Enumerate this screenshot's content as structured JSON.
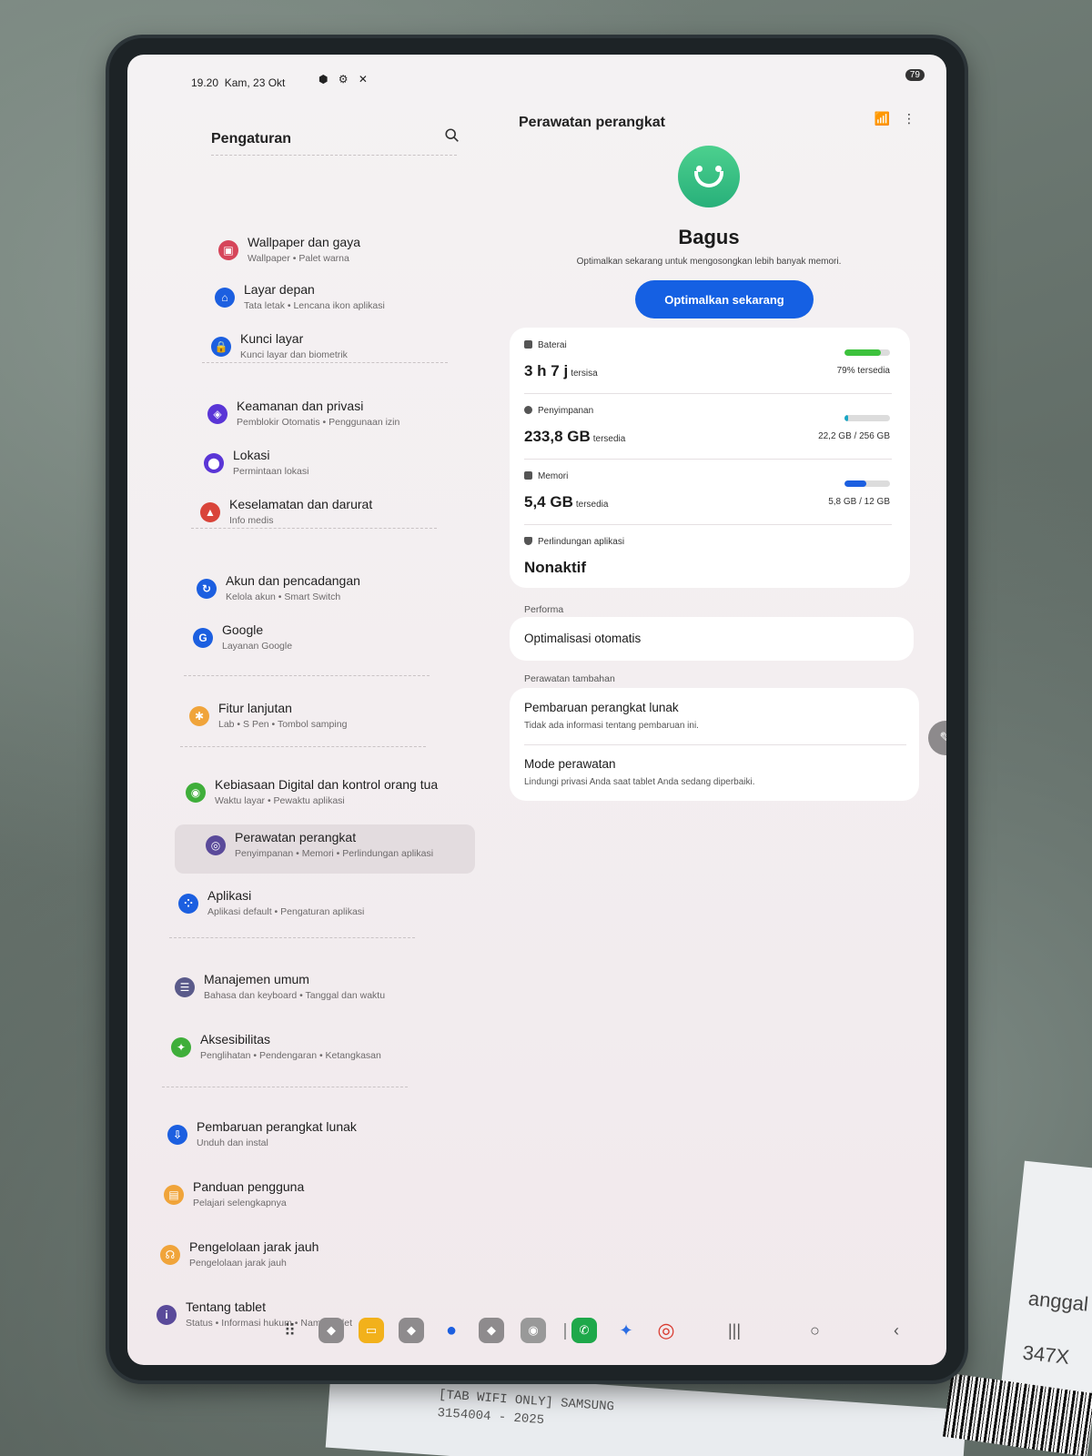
{
  "statusbar": {
    "time": "19.20",
    "date": "Kam, 23 Okt",
    "battery": "79"
  },
  "settings": {
    "title": "Pengaturan",
    "items": [
      {
        "icon": "wallpaper-icon",
        "color": "#d6455a",
        "title": "Wallpaper dan gaya",
        "subtitle": "Wallpaper • Palet warna"
      },
      {
        "icon": "home-icon",
        "color": "#1c5fe0",
        "title": "Layar depan",
        "subtitle": "Tata letak • Lencana ikon aplikasi"
      },
      {
        "icon": "lock-icon",
        "color": "#1c5fe0",
        "title": "Kunci layar",
        "subtitle": "Kunci layar dan biometrik"
      },
      {
        "icon": "shield-icon",
        "color": "#5a35d6",
        "title": "Keamanan dan privasi",
        "subtitle": "Pemblokir Otomatis • Penggunaan izin"
      },
      {
        "icon": "location-icon",
        "color": "#5a35d6",
        "title": "Lokasi",
        "subtitle": "Permintaan lokasi"
      },
      {
        "icon": "alert-icon",
        "color": "#d9443a",
        "title": "Keselamatan dan darurat",
        "subtitle": "Info medis"
      },
      {
        "icon": "sync-icon",
        "color": "#1c5fe0",
        "title": "Akun dan pencadangan",
        "subtitle": "Kelola akun • Smart Switch"
      },
      {
        "icon": "google-icon",
        "color": "#1c5fe0",
        "title": "Google",
        "subtitle": "Layanan Google"
      },
      {
        "icon": "gear-plus-icon",
        "color": "#f0a43a",
        "title": "Fitur lanjutan",
        "subtitle": "Lab • S Pen • Tombol samping"
      },
      {
        "icon": "wellbeing-icon",
        "color": "#3fae3a",
        "title": "Kebiasaan Digital dan kontrol orang tua",
        "subtitle": "Waktu layar • Pewaktu aplikasi"
      },
      {
        "icon": "device-care-icon",
        "color": "#5a4a9a",
        "title": "Perawatan perangkat",
        "subtitle": "Penyimpanan • Memori • Perlindungan aplikasi"
      },
      {
        "icon": "apps-icon",
        "color": "#1c5fe0",
        "title": "Aplikasi",
        "subtitle": "Aplikasi default • Pengaturan aplikasi"
      },
      {
        "icon": "sliders-icon",
        "color": "#5a5a8a",
        "title": "Manajemen umum",
        "subtitle": "Bahasa dan keyboard • Tanggal dan waktu"
      },
      {
        "icon": "accessibility-icon",
        "color": "#3fae3a",
        "title": "Aksesibilitas",
        "subtitle": "Penglihatan • Pendengaran • Ketangkasan"
      },
      {
        "icon": "software-update-icon",
        "color": "#1c5fe0",
        "title": "Pembaruan perangkat lunak",
        "subtitle": "Unduh dan instal"
      },
      {
        "icon": "manual-icon",
        "color": "#f0a43a",
        "title": "Panduan pengguna",
        "subtitle": "Pelajari selengkapnya"
      },
      {
        "icon": "headset-icon",
        "color": "#f0a43a",
        "title": "Pengelolaan jarak jauh",
        "subtitle": "Pengelolaan jarak jauh"
      },
      {
        "icon": "info-icon",
        "color": "#5a4a9a",
        "title": "Tentang tablet",
        "subtitle": "Status • Informasi hukum • Nama tablet"
      }
    ]
  },
  "device_care": {
    "title": "Perawatan perangkat",
    "status": "Bagus",
    "status_sub": "Optimalkan sekarang untuk mengosongkan lebih banyak memori.",
    "optimize_button": "Optimalkan sekarang",
    "battery": {
      "label": "Baterai",
      "value": "3 h 7 j",
      "unit": "tersisa",
      "side": "79% tersedia",
      "fraction": 0.79,
      "color": "#3cc23c"
    },
    "storage": {
      "label": "Penyimpanan",
      "value": "233,8 GB",
      "unit": "tersedia",
      "side": "22,2 GB / 256 GB",
      "fraction": 0.087,
      "color": "#1aa6c4"
    },
    "memory": {
      "label": "Memori",
      "value": "5,4 GB",
      "unit": "tersedia",
      "side": "5,8 GB / 12 GB",
      "fraction": 0.48,
      "color": "#1c5fe0"
    },
    "app_protection": {
      "label": "Perlindungan aplikasi",
      "value": "Nonaktif"
    },
    "performance_label": "Performa",
    "auto_optimize": "Optimalisasi otomatis",
    "extra_label": "Perawatan tambahan",
    "software_update": {
      "title": "Pembaruan perangkat lunak",
      "subtitle": "Tidak ada informasi tentang pembaruan ini."
    },
    "maintenance_mode": {
      "title": "Mode perawatan",
      "subtitle": "Lindungi privasi Anda saat tablet Anda sedang diperbaiki."
    }
  },
  "background_label": {
    "line1": "[TAB WIFI ONLY] SAMSUNG",
    "line2": "3154004 - 2025",
    "side1": "anggal",
    "side2": "347X"
  }
}
